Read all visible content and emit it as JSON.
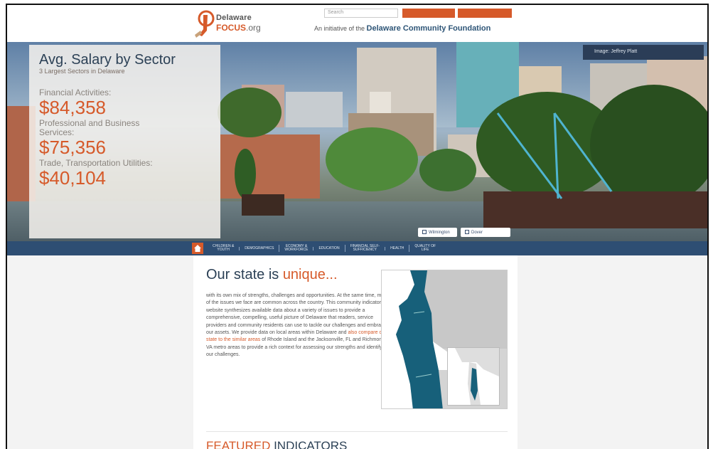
{
  "header": {
    "logo_line1": "Delaware",
    "logo_line2": "FOCUS",
    "logo_line2_suffix": ".org",
    "search_placeholder": "Search",
    "tagline_prefix": "An initiative of the ",
    "tagline_brand": "Delaware Community Foundation"
  },
  "hero": {
    "title": "Avg. Salary by Sector",
    "subtitle": "3 Largest Sectors in Delaware",
    "stats": [
      {
        "label": "Financial Activities:",
        "value": "$84,358"
      },
      {
        "label": "Professional and Business Services:",
        "value": "$75,356"
      },
      {
        "label": "Trade, Transportation Utilities:",
        "value": "$40,104"
      }
    ],
    "credit": "Image: Jeffrey Platt",
    "btn1": "Wilmington",
    "btn2": "Dover"
  },
  "nav": {
    "items": [
      [
        "CHILDREN &",
        "YOUTH"
      ],
      [
        "DEMOGRAPHICS",
        ""
      ],
      [
        "ECONOMY &",
        "WORKFORCE"
      ],
      [
        "EDUCATION",
        ""
      ],
      [
        "FINANCIAL SELF-",
        "SUFFICIENCY"
      ],
      [
        "HEALTH",
        ""
      ],
      [
        "QUALITY OF",
        "LIFE"
      ]
    ]
  },
  "content": {
    "heading_prefix": "Our state is ",
    "heading_highlight": "unique...",
    "body_1": "with its own mix of strengths, challenges and opportunities. At the same time, many of the issues we face are common across the country. This community indicators website synthesizes available data about a variety of issues to provide a comprehensive, compelling, useful picture of Delaware that readers, service providers and community residents can use to tackle our challenges and embrace our assets. We provide data on local areas within Delaware and ",
    "body_link": "also compare our state to the similar areas",
    "body_2": " of Rhode Island and the Jacksonville, FL and Richmond, VA metro areas to provide a rich context for assessing our strengths and identifying our challenges.",
    "featured_highlight": "FEATURED",
    "featured_rest": " INDICATORS"
  },
  "colors": {
    "accent": "#d65a2a",
    "navy": "#2e4e73",
    "heading": "#2c4156",
    "map_teal": "#17607a"
  }
}
